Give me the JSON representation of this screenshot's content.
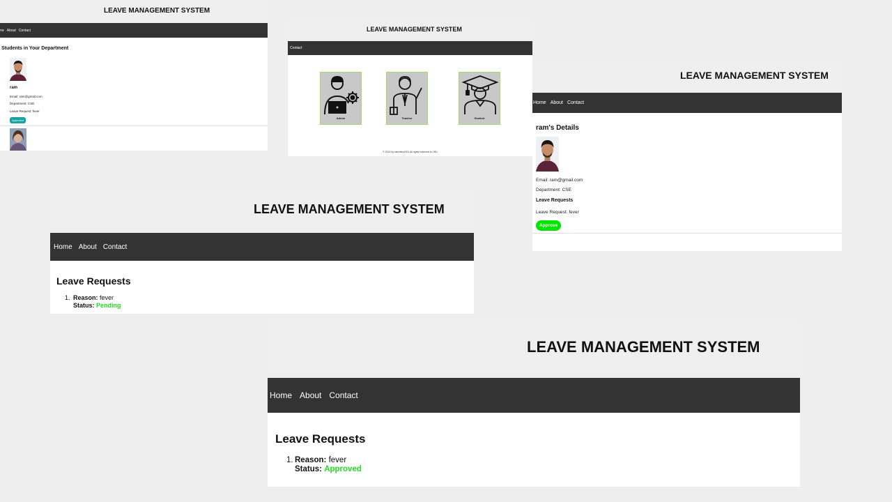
{
  "app_title": "LEAVE MANAGEMENT SYSTEM",
  "nav": {
    "home": "Home",
    "about": "About",
    "contact": "Contact",
    "home_cropped": "ome",
    "about_cropped": "ut"
  },
  "colors": {
    "navbar": "#333333",
    "title_bg": "#efefef",
    "approve_green": "#00e600",
    "status_green": "#22dd22",
    "teal": "#17a2a2",
    "card_gray": "#c8c8c8"
  },
  "hod_students_view": {
    "section_heading": "Students in Your Department",
    "student": {
      "name": "ram",
      "email_line": "Email: ram@gmail.com",
      "department_line": "Department: CSE",
      "leave_request_line": "Leave Request: fever",
      "action_label": "Approved"
    }
  },
  "role_select_view": {
    "roles": [
      {
        "label": "Admin",
        "icon": "admin-icon"
      },
      {
        "label": "Teacher",
        "icon": "teacher-icon"
      },
      {
        "label": "Student",
        "icon": "student-icon"
      }
    ],
    "footer": "© 2024 by rakshitry1001 All rights reserved to 1RU"
  },
  "student_details_view": {
    "heading": "ram's Details",
    "email_line": "Email: ram@gmail.com",
    "department_line": "Department: CSE",
    "leave_requests_heading": "Leave Requests",
    "leave_request_line": "Leave Request: fever",
    "approve_label": "Approve"
  },
  "leave_requests_pending_view": {
    "heading": "Leave Requests",
    "item_number": "1.",
    "reason_label": "Reason:",
    "reason_value": "fever",
    "status_label": "Status:",
    "status_value": "Pending"
  },
  "leave_requests_approved_view": {
    "heading": "Leave Requests",
    "item_number": "1.",
    "reason_label": "Reason:",
    "reason_value": "fever",
    "status_label": "Status:",
    "status_value": "Approved"
  }
}
